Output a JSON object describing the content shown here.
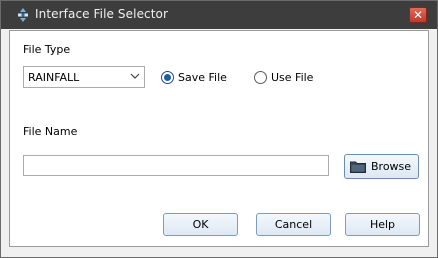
{
  "window": {
    "title": "Interface File Selector",
    "close_glyph": "✕"
  },
  "file_type": {
    "label": "File Type",
    "selected": "RAINFALL"
  },
  "mode": {
    "save_label": "Save File",
    "use_label": "Use File",
    "selected": "save"
  },
  "file_name": {
    "label": "File Name",
    "value": "",
    "browse_label": "Browse"
  },
  "buttons": {
    "ok": "OK",
    "cancel": "Cancel",
    "help": "Help"
  },
  "colors": {
    "titlebar": "#3d3d3d",
    "close": "#c2382a",
    "radio_selected": "#1f5e9e"
  }
}
